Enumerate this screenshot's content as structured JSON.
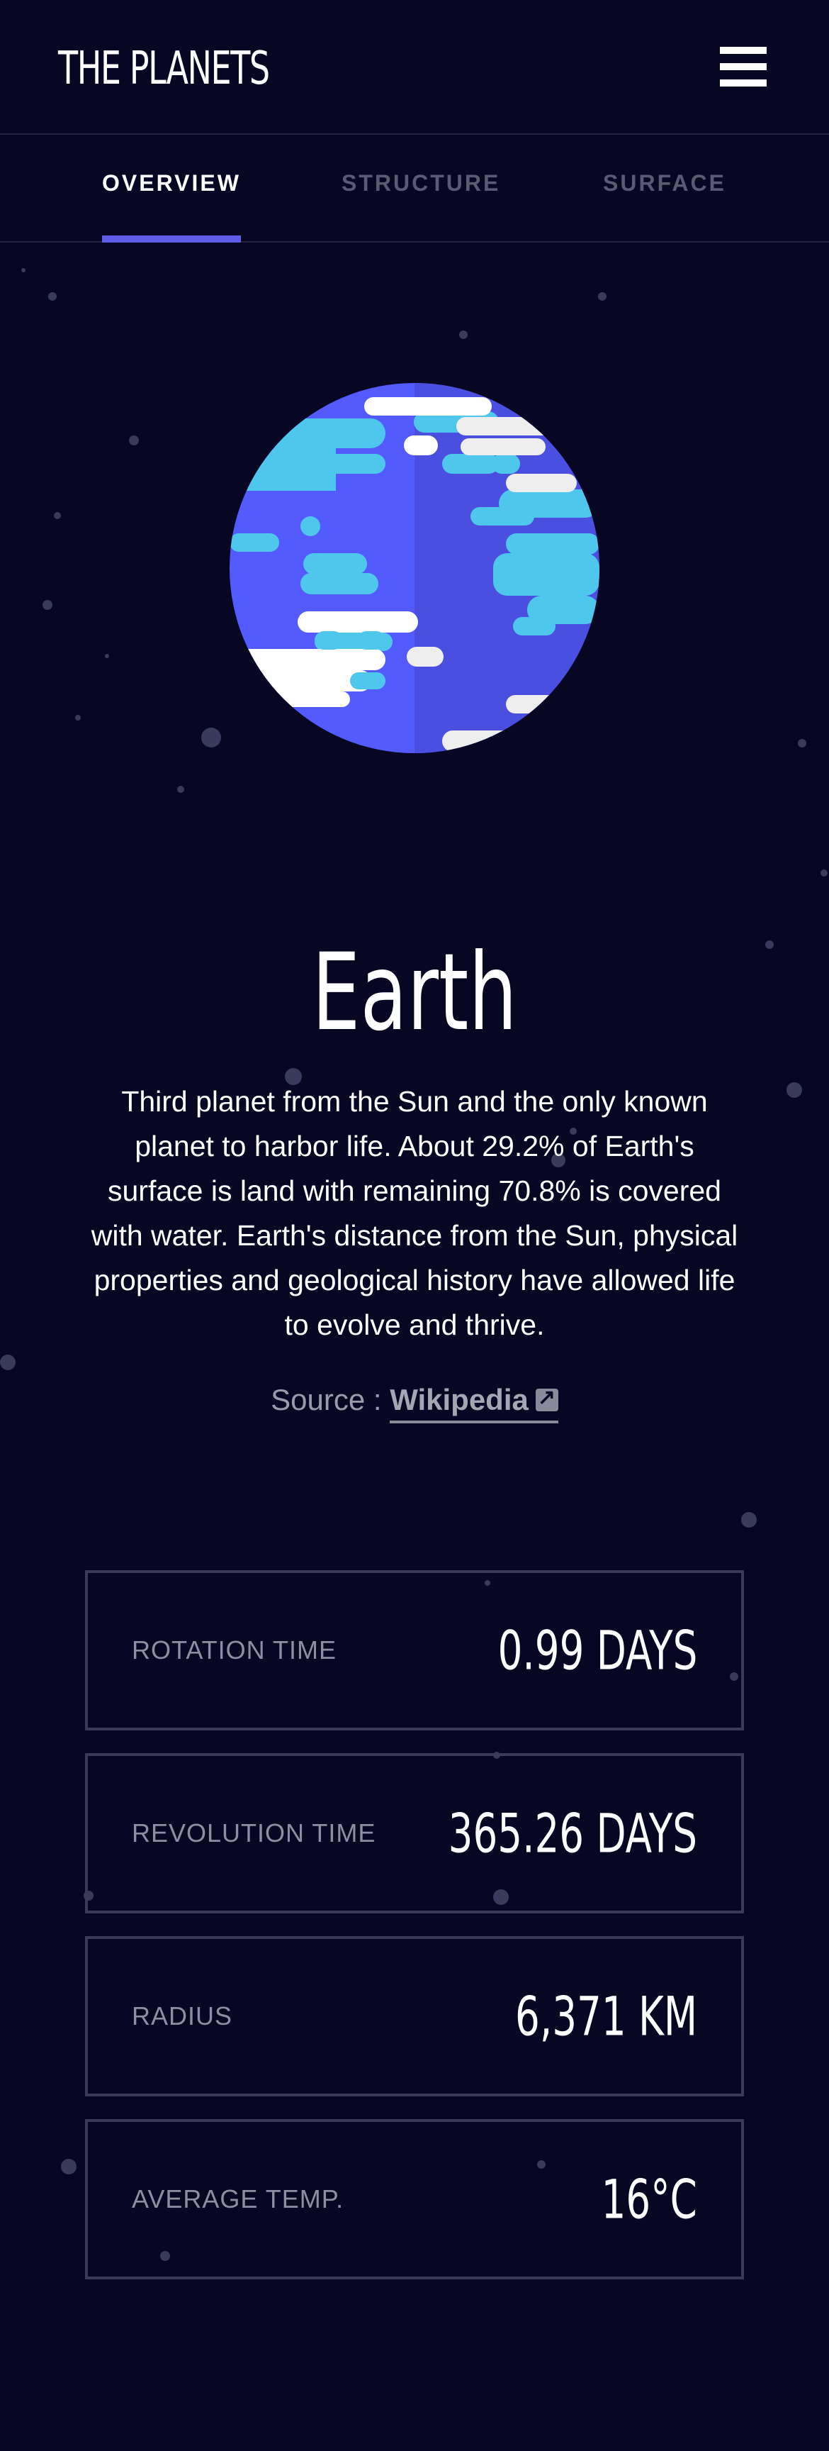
{
  "header": {
    "logo": "THE PLANETS"
  },
  "tabs": [
    {
      "label": "OVERVIEW",
      "active": true
    },
    {
      "label": "STRUCTURE",
      "active": false
    },
    {
      "label": "SURFACE",
      "active": false
    }
  ],
  "planet": {
    "name": "Earth",
    "description": "Third planet from the Sun and the only known planet to harbor life. About 29.2% of Earth's surface is land with remaining 70.8% is covered with water. Earth's distance from the Sun, physical properties and geological history have allowed life to evolve and thrive.",
    "source_prefix": "Source : ",
    "source_link": "Wikipedia"
  },
  "stats": [
    {
      "label": "ROTATION TIME",
      "value": "0.99 DAYS"
    },
    {
      "label": "REVOLUTION TIME",
      "value": "365.26 DAYS"
    },
    {
      "label": "RADIUS",
      "value": "6,371 KM"
    },
    {
      "label": "AVERAGE TEMP.",
      "value": "16°C"
    }
  ],
  "colors": {
    "background": "#070724",
    "accent": "#5f5ce8",
    "planet_ocean": "#545bfe",
    "planet_land": "#4fc7ed"
  }
}
